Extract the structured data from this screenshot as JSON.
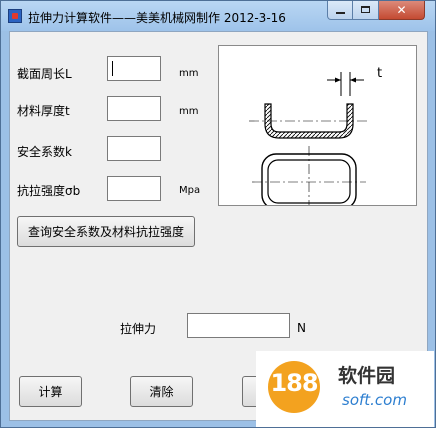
{
  "window": {
    "title": "拉伸力计算软件——美美机械网制作   2012-3-16",
    "close_glyph": "✕"
  },
  "inputs": [
    {
      "label": "截面周长L",
      "value": "",
      "unit": "mm"
    },
    {
      "label": "材料厚度t",
      "value": "",
      "unit": "mm"
    },
    {
      "label": "安全系数k",
      "value": "",
      "unit": ""
    },
    {
      "label": "抗拉强度σb",
      "value": "",
      "unit": "Mpa"
    }
  ],
  "lookup_button": "查询安全系数及材料抗拉强度",
  "diagram": {
    "dimension_label": "t"
  },
  "result": {
    "label": "拉伸力",
    "value": "",
    "unit": "N"
  },
  "buttons": {
    "calc": "计算",
    "clear": "清除"
  },
  "watermark": {
    "logo_number": "188",
    "name": "软件园",
    "domain": "soft.com"
  },
  "colors": {
    "frame": "#9cc0e6",
    "close": "#c44a32",
    "watermark_orange": "#f3a21f",
    "watermark_blue": "#2e7fd0"
  }
}
